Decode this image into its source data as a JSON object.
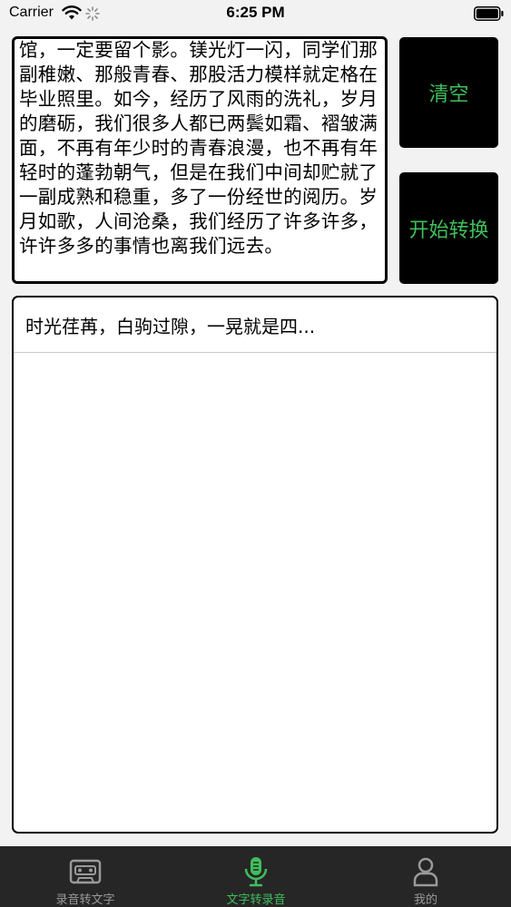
{
  "status_bar": {
    "carrier": "Carrier",
    "time": "6:25 PM"
  },
  "input": {
    "text": "馆，一定要留个影。镁光灯一闪，同学们那副稚嫩、那般青春、那股活力模样就定格在毕业照里。如今，经历了风雨的洗礼，岁月的磨砺，我们很多人都已两鬓如霜、褶皱满面，不再有年少时的青春浪漫，也不再有年轻时的蓬勃朝气，但是在我们中间却贮就了一副成熟和稳重，多了一份经世的阅历。岁月如歌，人间沧桑，我们经历了许多许多，许许多多的事情也离我们远去。"
  },
  "buttons": {
    "clear": "清空",
    "convert": "开始转换"
  },
  "history": {
    "items": [
      "时光荏苒，白驹过隙，一晃就是四..."
    ]
  },
  "tabs": [
    {
      "label": "录音转文字",
      "icon": "cassette-icon",
      "active": false
    },
    {
      "label": "文字转录音",
      "icon": "microphone-icon",
      "active": true
    },
    {
      "label": "我的",
      "icon": "person-icon",
      "active": false
    }
  ],
  "colors": {
    "accent": "#3fbf5c",
    "tab_bar": "#262626",
    "tab_inactive": "#9a9a9a",
    "background": "#f2f2f2"
  }
}
